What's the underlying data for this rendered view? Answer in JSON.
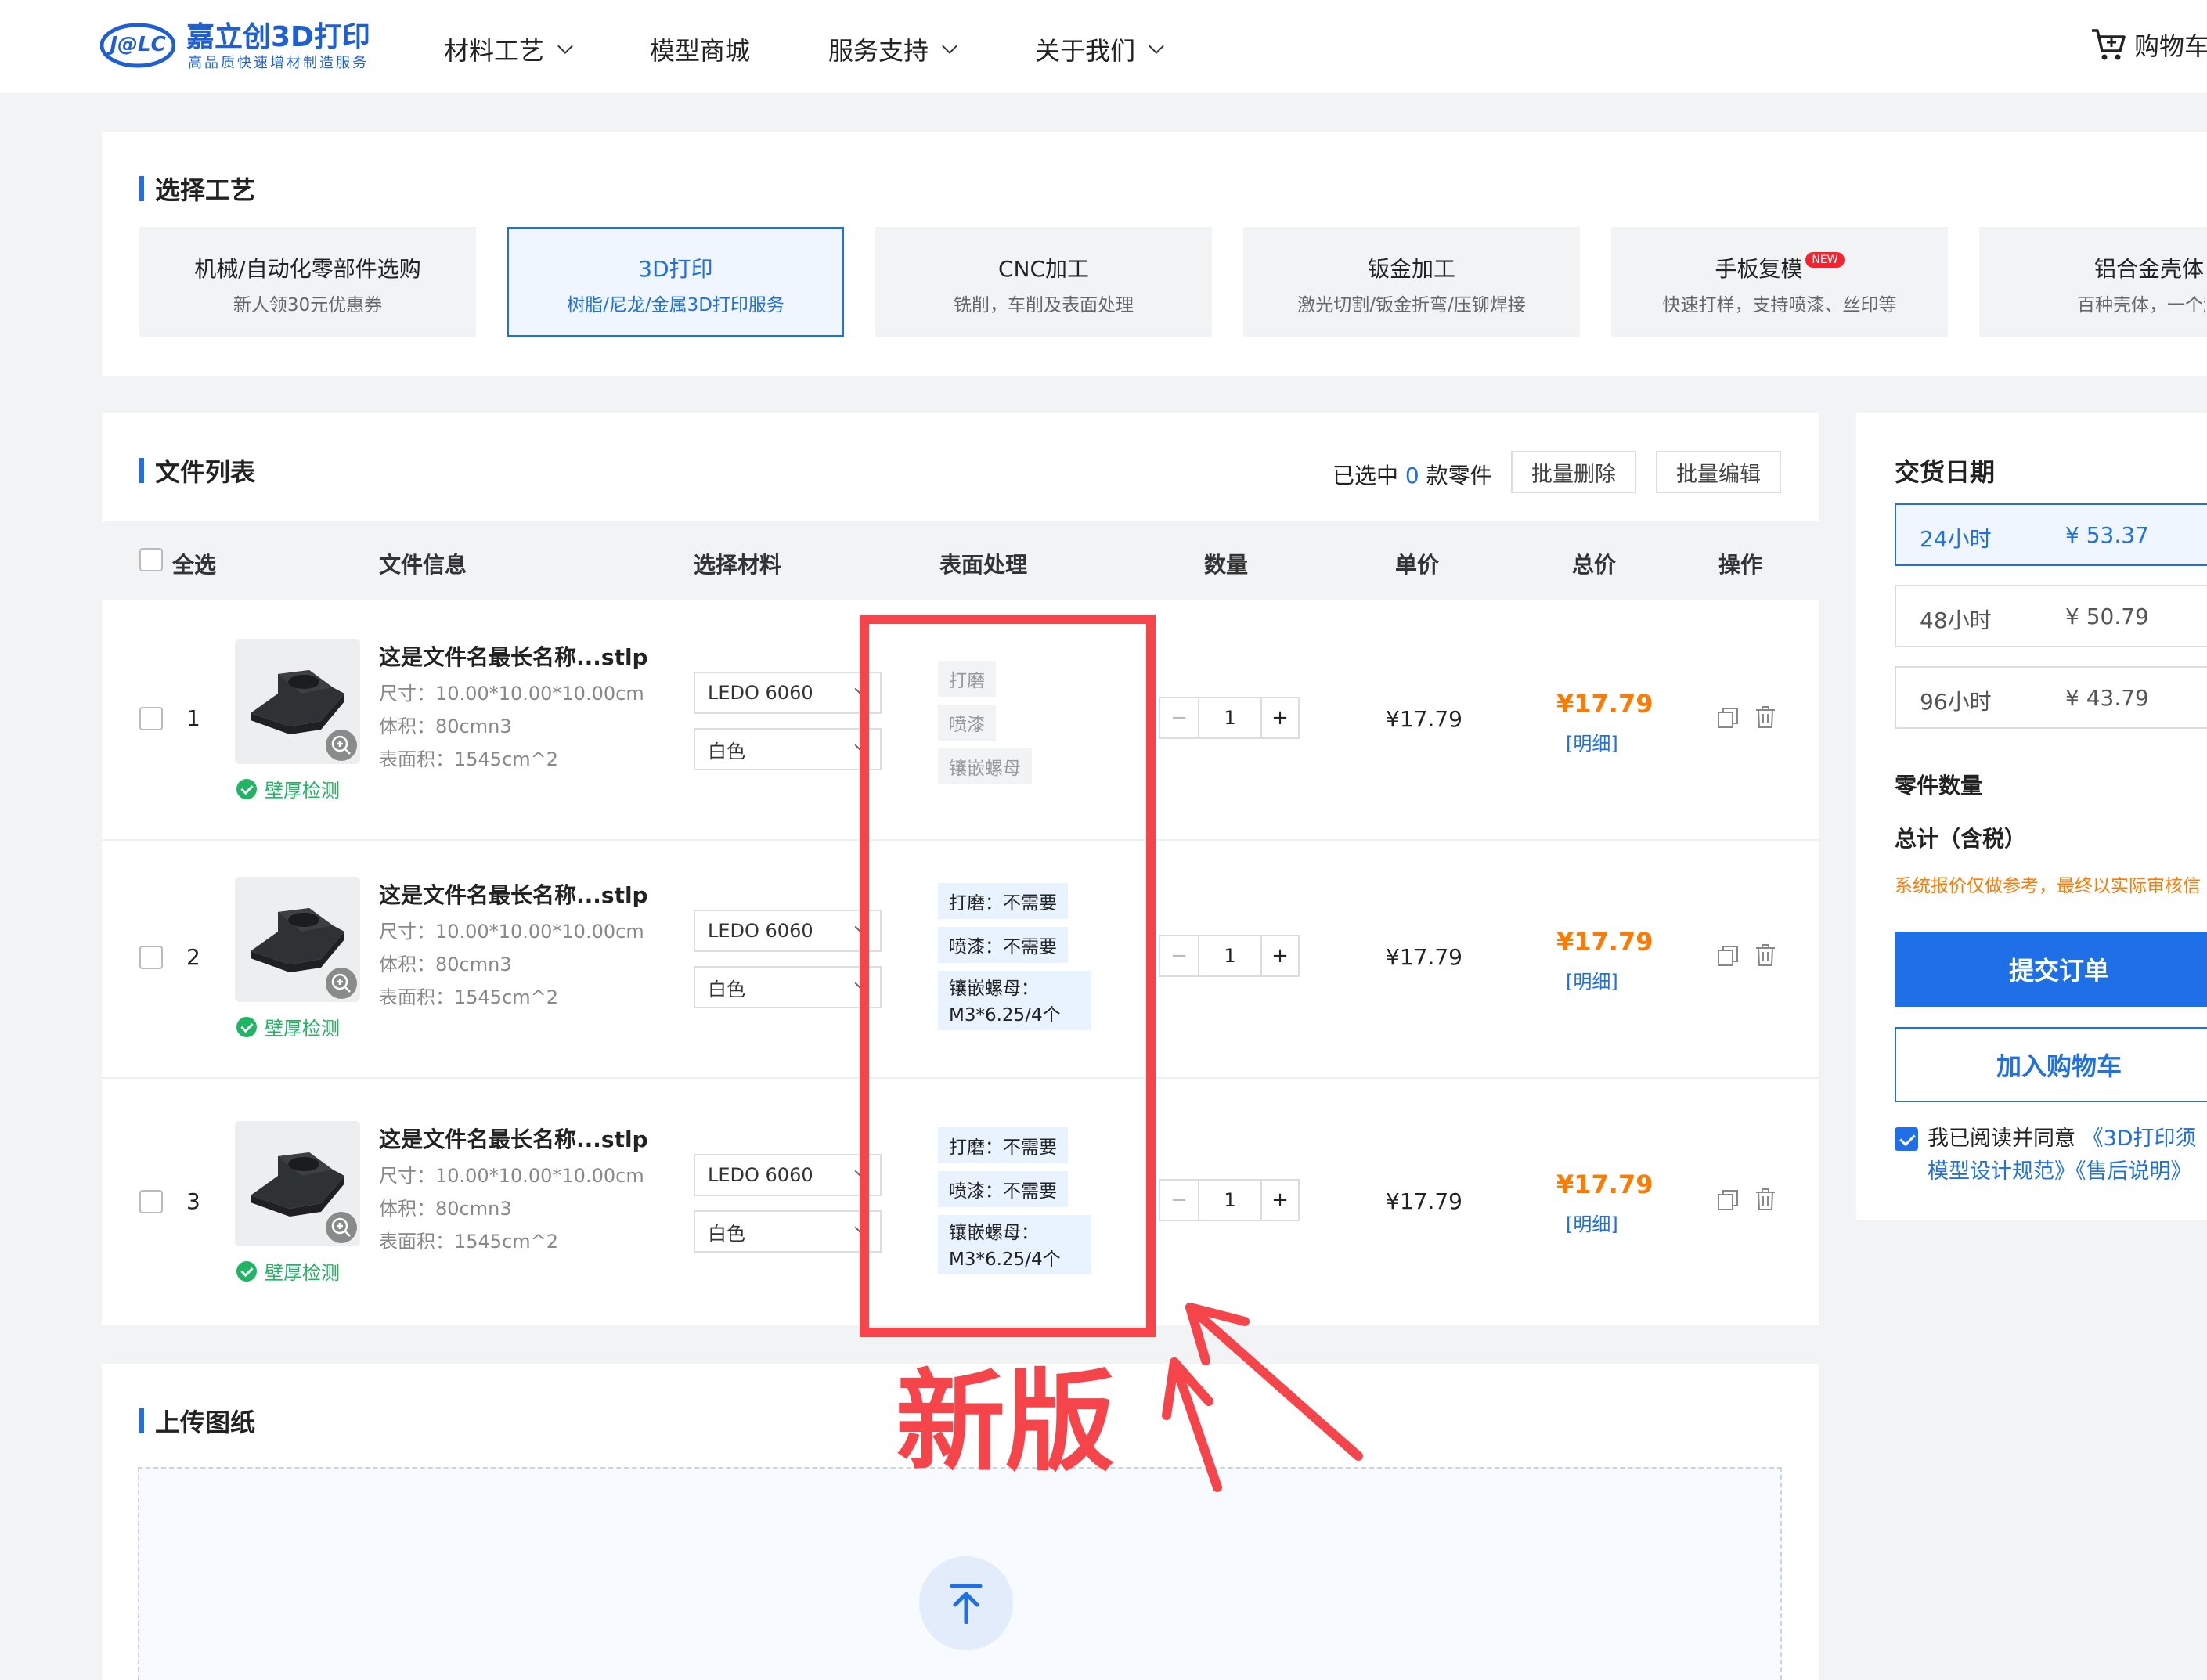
{
  "header": {
    "logo_text": "J@LC",
    "brand_name": "嘉立创3D打印",
    "brand_slogan": "高品质快速增材制造服务",
    "nav": [
      {
        "label": "材料工艺",
        "has_dropdown": true
      },
      {
        "label": "模型商城",
        "has_dropdown": false
      },
      {
        "label": "服务支持",
        "has_dropdown": true
      },
      {
        "label": "关于我们",
        "has_dropdown": true
      }
    ],
    "cart_label": "购物车"
  },
  "process": {
    "title": "选择工艺",
    "tiles": [
      {
        "title": "机械/自动化零部件选购",
        "subtitle": "新人领30元优惠券",
        "active": false
      },
      {
        "title": "3D打印",
        "subtitle": "树脂/尼龙/金属3D打印服务",
        "active": true
      },
      {
        "title": "CNC加工",
        "subtitle": "铣削，车削及表面处理",
        "active": false
      },
      {
        "title": "钣金加工",
        "subtitle": "激光切割/钣金折弯/压铆焊接",
        "active": false
      },
      {
        "title": "手板复模",
        "subtitle": "快速打样，支持喷漆、丝印等",
        "active": false,
        "badge": "NEW"
      },
      {
        "title": "铝合金壳体",
        "subtitle": "百种壳体，一个起",
        "active": false
      }
    ]
  },
  "files": {
    "title": "文件列表",
    "selected_prefix": "已选中",
    "selected_count": "0",
    "selected_suffix": "款零件",
    "batch_delete": "批量删除",
    "batch_edit": "批量编辑",
    "columns": {
      "select_all": "全选",
      "file_info": "文件信息",
      "material": "选择材料",
      "surface": "表面处理",
      "quantity": "数量",
      "unit_price": "单价",
      "total_price": "总价",
      "actions": "操作"
    },
    "rows": [
      {
        "index": "1",
        "name": "这是文件名最长名称...stlp",
        "size": "尺寸：10.00*10.00*10.00cm",
        "volume": "体积：80cmn3",
        "area": "表面积：1545cm^2",
        "wall_check": "壁厚检测",
        "material": "LEDO 6060",
        "color": "白色",
        "surface": [
          "打磨",
          "喷漆",
          "镶嵌螺母"
        ],
        "qty": "1",
        "unit_price": "¥17.79",
        "total": "¥17.79",
        "detail": "[明细]"
      },
      {
        "index": "2",
        "name": "这是文件名最长名称...stlp",
        "size": "尺寸：10.00*10.00*10.00cm",
        "volume": "体积：80cmn3",
        "area": "表面积：1545cm^2",
        "wall_check": "壁厚检测",
        "material": "LEDO 6060",
        "color": "白色",
        "surface": [
          "打磨：不需要",
          "喷漆：不需要",
          "镶嵌螺母：",
          "M3*6.25/4个"
        ],
        "qty": "1",
        "unit_price": "¥17.79",
        "total": "¥17.79",
        "detail": "[明细]"
      },
      {
        "index": "3",
        "name": "这是文件名最长名称...stlp",
        "size": "尺寸：10.00*10.00*10.00cm",
        "volume": "体积：80cmn3",
        "area": "表面积：1545cm^2",
        "wall_check": "壁厚检测",
        "material": "LEDO 6060",
        "color": "白色",
        "surface": [
          "打磨：不需要",
          "喷漆：不需要",
          "镶嵌螺母：",
          "M3*6.25/4个"
        ],
        "qty": "1",
        "unit_price": "¥17.79",
        "total": "¥17.79",
        "detail": "[明细]"
      }
    ]
  },
  "upload": {
    "title": "上传图纸"
  },
  "sidebar": {
    "delivery_title": "交货日期",
    "delivery_options": [
      {
        "time": "24小时",
        "price": "¥ 53.37",
        "active": true
      },
      {
        "time": "48小时",
        "price": "¥ 50.79",
        "active": false
      },
      {
        "time": "96小时",
        "price": "¥ 43.79",
        "active": false
      }
    ],
    "part_count_label": "零件数量",
    "total_label": "总计（含税）",
    "notice": "系统报价仅做参考，最终以实际审核信",
    "submit_label": "提交订单",
    "add_cart_label": "加入购物车",
    "agree_prefix": "我已阅读并同意",
    "agree_link1": "《3D打印须",
    "agree_link2": "模型设计规范》",
    "agree_link3": "《售后说明》"
  },
  "annotation": {
    "text": "新版"
  },
  "colors": {
    "accent": "#1f6fe6",
    "price_orange": "#ff7a00",
    "annotation_red": "#f5454b",
    "success_green": "#20b463"
  }
}
